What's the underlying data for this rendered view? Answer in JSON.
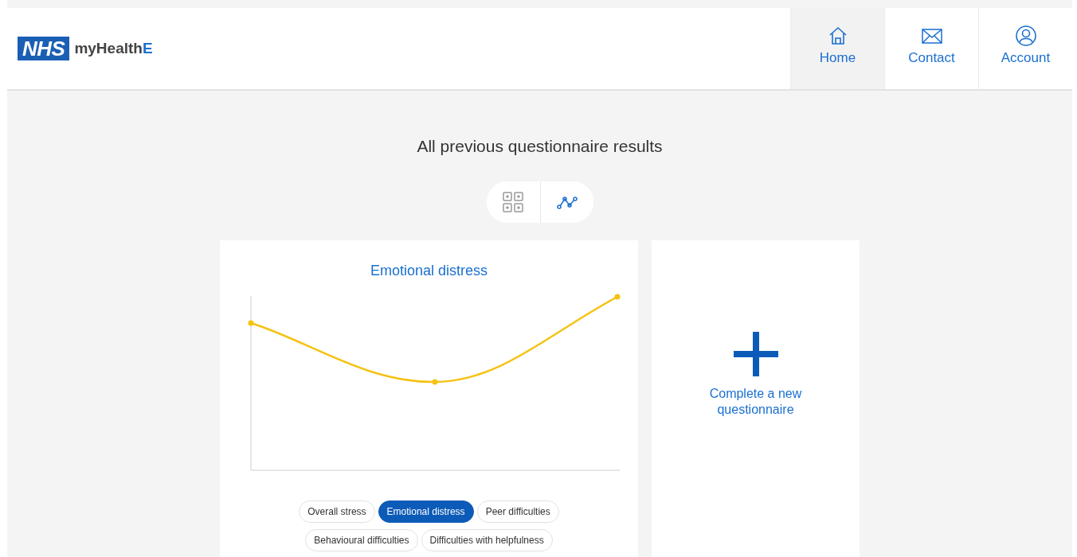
{
  "header": {
    "logo": {
      "badge": "NHS",
      "name": "myHealth",
      "accent": "E"
    },
    "nav": [
      {
        "label": "Home",
        "kind": "home",
        "selected": true
      },
      {
        "label": "Contact",
        "kind": "mail",
        "selected": false
      },
      {
        "label": "Account",
        "kind": "user",
        "selected": false
      }
    ]
  },
  "page_title": "All previous questionnaire results",
  "view_toggle": [
    {
      "kind": "grid",
      "selected": false
    },
    {
      "kind": "chart",
      "selected": true
    }
  ],
  "chart_card": {
    "title": "Emotional distress",
    "filters": [
      {
        "label": "Overall stress",
        "selected": false
      },
      {
        "label": "Emotional distress",
        "selected": true
      },
      {
        "label": "Peer difficulties",
        "selected": false
      },
      {
        "label": "Behavioural difficulties",
        "selected": false
      },
      {
        "label": "Difficulties with helpfulness",
        "selected": false
      }
    ]
  },
  "new_card": {
    "label": "Complete a new questionnaire"
  }
}
